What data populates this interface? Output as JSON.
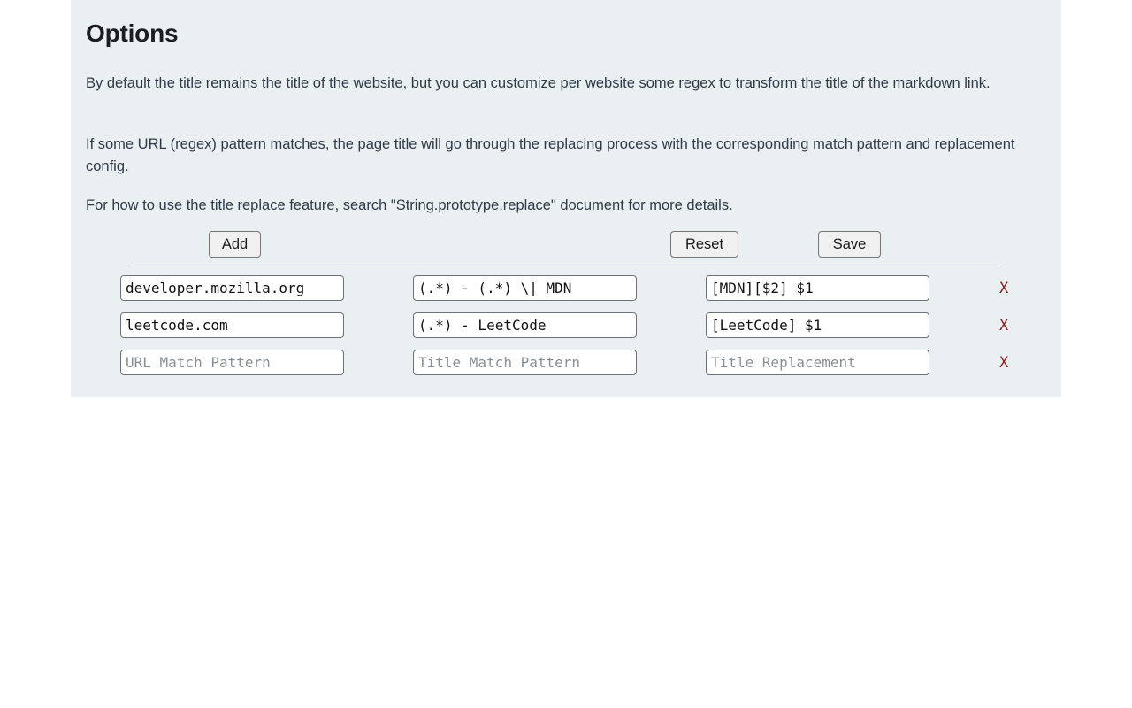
{
  "header": {
    "title": "Options"
  },
  "descriptions": [
    "By default the title remains the title of the website, but you can customize per website some regex to transform the title of the markdown link.",
    "If some URL (regex) pattern matches, the page title will go through the replacing process with the corresponding match pattern and replacement config.",
    "For how to use the title replace feature, search \"String.prototype.replace\" document for more details."
  ],
  "toolbar": {
    "add_label": "Add",
    "reset_label": "Reset",
    "save_label": "Save"
  },
  "table": {
    "placeholders": {
      "url_match_pattern": "URL Match Pattern",
      "title_match_pattern": "Title Match Pattern",
      "title_replacement": "Title Replacement"
    },
    "remove_label": "X",
    "rows": [
      {
        "url_pattern": "developer.mozilla.org",
        "title_pattern": "(.*) - (.*) \\| MDN",
        "title_replacement": "[MDN][$2] $1"
      },
      {
        "url_pattern": "leetcode.com",
        "title_pattern": "(.*) - LeetCode",
        "title_replacement": "[LeetCode] $1"
      },
      {
        "url_pattern": "",
        "title_pattern": "",
        "title_replacement": ""
      }
    ]
  },
  "colors": {
    "card_background": "#eaeff2",
    "page_background": "#ffffff",
    "text": "#2e3a46",
    "heading": "#1c1c22",
    "remove_accent": "#8b2020",
    "divider": "#9aa3ab",
    "placeholder": "#8a8f94"
  }
}
